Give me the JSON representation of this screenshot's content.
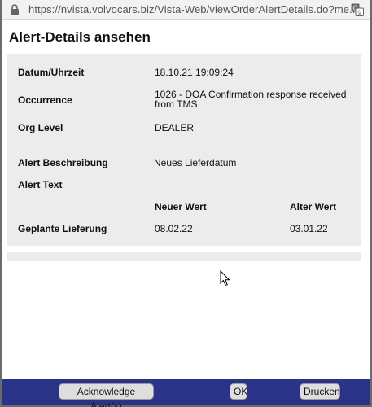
{
  "browser": {
    "url": "https://nvista.volvocars.biz/Vista-Web/viewOrderAlertDetails.do?me..."
  },
  "page": {
    "title": "Alert-Details ansehen"
  },
  "details": {
    "datum_label": "Datum/Uhrzeit",
    "datum_value": "18.10.21 19:09:24",
    "occurrence_label": "Occurrence",
    "occurrence_value": "1026 - DOA Confirmation response received from TMS",
    "org_level_label": "Org Level",
    "org_level_value": "DEALER",
    "beschreibung_label": "Alert Beschreibung",
    "beschreibung_value": "Neues Lieferdatum",
    "alert_text_label": "Alert Text"
  },
  "values_table": {
    "new_header": "Neuer Wert",
    "old_header": "Alter Wert",
    "row_label": "Geplante Lieferung",
    "new_value": "08.02.22",
    "old_value": "03.01.22"
  },
  "footer": {
    "acknowledge_label": "Acknowledge Alert(s)",
    "ok_label": "OK",
    "print_label": "Drucken"
  },
  "colors": {
    "footer_bg": "#2b3388",
    "panel_bg": "#ececec"
  }
}
